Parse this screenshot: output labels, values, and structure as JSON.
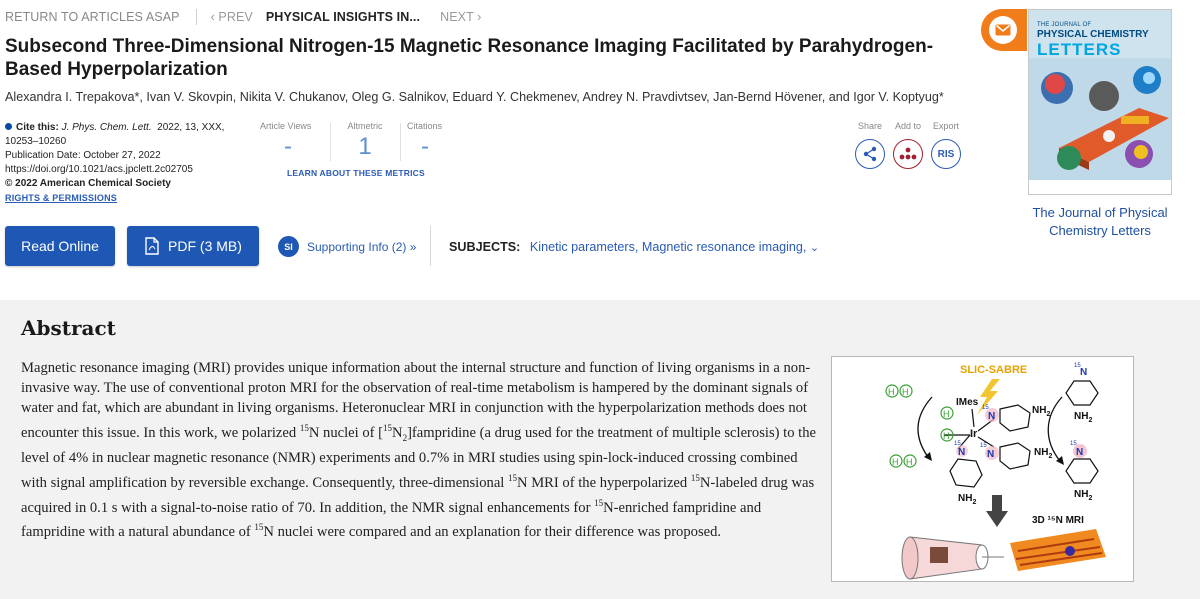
{
  "nav": {
    "return": "RETURN TO ARTICLES ASAP",
    "prev": "PREV",
    "current": "PHYSICAL INSIGHTS IN...",
    "next": "NEXT"
  },
  "article": {
    "title": "Subsecond Three-Dimensional Nitrogen-15 Magnetic Resonance Imaging Facilitated by Parahydrogen-Based Hyperpolarization",
    "authors": "Alexandra I. Trepakova*, Ivan V. Skovpin, Nikita V. Chukanov, Oleg G. Salnikov, Eduard Y. Chekmenev, Andrey N. Pravdivtsev, Jan-Bernd Hövener, and Igor V. Koptyug*"
  },
  "citation": {
    "cite_label": "Cite this:",
    "journal": "J. Phys. Chem. Lett.",
    "details": "2022, 13, XXX, 10253–10260",
    "pub_date": "Publication Date: October 27, 2022",
    "doi": "https://doi.org/10.1021/acs.jpclett.2c02705",
    "copyright": "© 2022 American Chemical Society",
    "rights": "RIGHTS & PERMISSIONS"
  },
  "metrics": {
    "views_label": "Article Views",
    "views_value": "-",
    "altmetric_label": "Altmetric",
    "altmetric_value": "1",
    "citations_label": "Citations",
    "citations_value": "-",
    "learn": "LEARN ABOUT THESE METRICS"
  },
  "actions": {
    "share_label": "Share",
    "add_label": "Add to",
    "export_label": "Export",
    "ris": "RIS"
  },
  "journal_cover": {
    "small_text": "THE JOURNAL OF",
    "line1": "PHYSICAL CHEMISTRY",
    "line2": "LETTERS",
    "caption": "The Journal of Physical Chemistry Letters"
  },
  "buttons": {
    "read_online": "Read Online",
    "pdf": "PDF (3 MB)",
    "si_badge": "SI",
    "supporting_info": "Supporting Info (2) »"
  },
  "subjects": {
    "label": "SUBJECTS:",
    "terms": "Kinetic parameters, Magnetic resonance imaging,"
  },
  "abstract": {
    "heading": "Abstract",
    "p1": "Magnetic resonance imaging (MRI) provides unique information about the internal structure and function of living organisms in a non-invasive way. The use of conventional proton MRI for the observation of real-time metabolism is hampered by the dominant signals of water and fat, which are abundant in living organisms. Heteronuclear MRI in conjunction with the hyperpolarization methods does not encounter this issue. In this work, we polarized ",
    "p2": "N nuclei of [",
    "p3": "]fampridine (a drug used for the treatment of multiple sclerosis) to the level of 4% in nuclear magnetic resonance (NMR) experiments and 0.7% in MRI studies using spin-lock-induced crossing combined with signal amplification by reversible exchange. Consequently, three-dimensional ",
    "p4": "N MRI of the hyperpolarized ",
    "p5": "N-labeled drug was acquired in 0.1 s with a signal-to-noise ratio of 70. In addition, the NMR signal enhancements for ",
    "p6": "N-enriched fampridine and fampridine with a natural abundance of ",
    "p7": "N nuclei were compared and an explanation for their difference was proposed.",
    "sup15": "15",
    "n2": "N",
    "sub2": "2"
  },
  "figure": {
    "slic_sabre": "SLIC-SABRE",
    "imes": "IMes",
    "ir": "Ir",
    "n15": "15",
    "n": "N",
    "nh2": "NH",
    "sub2": "2",
    "mri_label": "3D ¹⁵N MRI",
    "h": "H"
  }
}
